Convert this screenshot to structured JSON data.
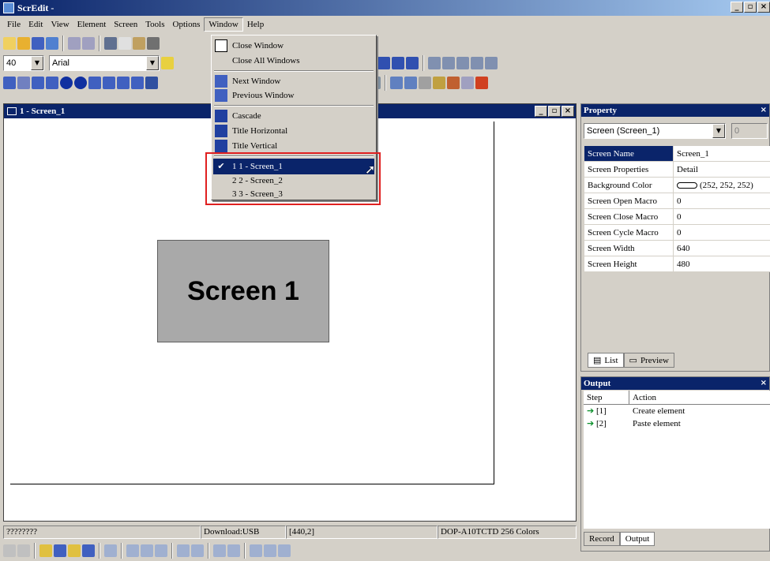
{
  "app": {
    "title": "ScrEdit -"
  },
  "menu": [
    "File",
    "Edit",
    "View",
    "Element",
    "Screen",
    "Tools",
    "Options",
    "Window",
    "Help"
  ],
  "toolbar2": {
    "font_size": "40",
    "font_name": "Arial"
  },
  "child_window": {
    "title": "1 - Screen_1",
    "screen_label": "Screen 1"
  },
  "window_menu": {
    "items": [
      {
        "label": "Close Window",
        "icon": "close-window-icon"
      },
      {
        "label": "Close All Windows",
        "icon": ""
      },
      {
        "label": "Next Window",
        "icon": "next-window-icon"
      },
      {
        "label": "Previous Window",
        "icon": "previous-window-icon"
      },
      {
        "label": "Cascade",
        "icon": "cascade-icon"
      },
      {
        "label": "Title Horizontal",
        "icon": "tile-horizontal-icon"
      },
      {
        "label": "Title Vertical",
        "icon": "tile-vertical-icon"
      }
    ],
    "windows": [
      {
        "label": "1 1 - Screen_1",
        "checked": true
      },
      {
        "label": "2 2 - Screen_2",
        "checked": false
      },
      {
        "label": "3 3 - Screen_3",
        "checked": false
      }
    ]
  },
  "property": {
    "title": "Property",
    "selector": "Screen (Screen_1)",
    "spin": "0",
    "rows": [
      {
        "key": "Screen Name",
        "value": "Screen_1"
      },
      {
        "key": "Screen Properties",
        "value": "Detail"
      },
      {
        "key": "Background Color",
        "value": "(252, 252, 252)"
      },
      {
        "key": "Screen Open Macro",
        "value": "0"
      },
      {
        "key": "Screen Close Macro",
        "value": "0"
      },
      {
        "key": "Screen Cycle Macro",
        "value": "0"
      },
      {
        "key": "Screen Width",
        "value": "640"
      },
      {
        "key": "Screen Height",
        "value": "480"
      }
    ],
    "tabs": [
      "List",
      "Preview"
    ]
  },
  "output": {
    "title": "Output",
    "columns": [
      "Step",
      "Action"
    ],
    "rows": [
      {
        "step": "[1]",
        "action": "Create element"
      },
      {
        "step": "[2]",
        "action": "Paste element"
      }
    ],
    "tabs": [
      "Record",
      "Output"
    ]
  },
  "status": {
    "left": "????????",
    "download": "Download:USB",
    "coords": "[440,2]",
    "device": "DOP-A10TCTD 256 Colors"
  },
  "colors": {
    "titlebar": "#0a246a",
    "highlight": "#e02020",
    "canvas_bg": "#fcfcfc"
  }
}
